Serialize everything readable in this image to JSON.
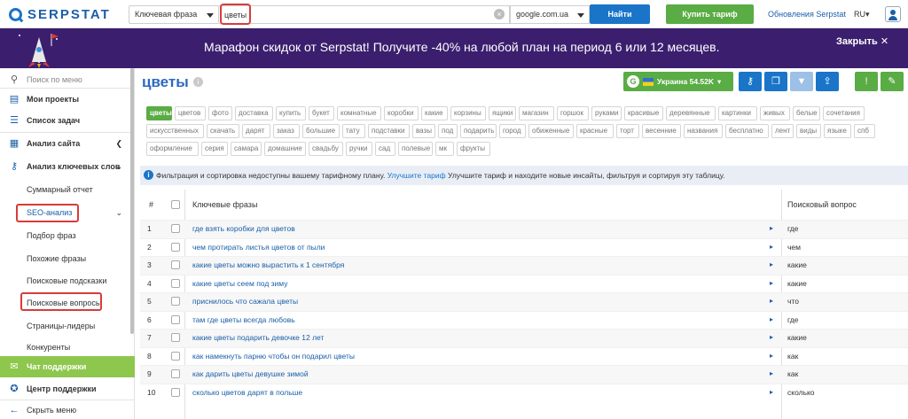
{
  "header": {
    "logo_text": "SERPSTAT",
    "search_type": "Ключевая фраза",
    "search_value": "цветы",
    "database": "google.com.ua",
    "find_label": "Найти",
    "buy_label": "Купить тариф",
    "updates_label": "Обновления Serpstat",
    "lang_label": "RU"
  },
  "banner": {
    "text": "Марафон скидок от Serpstat! Получите -40% на любой план на период 6 или 12 месяцев.",
    "close_label": "Закрыть ✕"
  },
  "sidebar": {
    "search_placeholder": "Поиск по меню",
    "my_projects": "Мои проекты",
    "task_list": "Список задач",
    "site_analysis": "Анализ сайта",
    "keyword_analysis": "Анализ ключевых слов",
    "summary_report": "Суммарный отчет",
    "seo_analysis": "SEO-анализ",
    "phrase_selection": "Подбор фраз",
    "similar_phrases": "Похожие фразы",
    "search_suggestions": "Поисковые подсказки",
    "search_questions": "Поисковые вопросы",
    "top_pages": "Страницы-лидеры",
    "competitors": "Конкуренты",
    "support_chat": "Чат поддержки",
    "help_center": "Центр поддержки",
    "collapse_menu": "Скрыть меню"
  },
  "main": {
    "title": "цветы",
    "region_label": "Украина 54.52K",
    "tags": [
      "цветы",
      "цветов",
      "фото",
      "доставка",
      "купить",
      "букет",
      "комнатные",
      "коробки",
      "какие",
      "корзины",
      "ящики",
      "магазин",
      "горшок",
      "руками",
      "красивые",
      "деревянные",
      "картинки",
      "живых",
      "белые",
      "сочетания",
      "искусственных",
      "скачать",
      "дарят",
      "заказ",
      "большие",
      "тату",
      "подставки",
      "вазы",
      "под",
      "подарить",
      "город",
      "обиженные",
      "красные",
      "торт",
      "весенние",
      "названия",
      "бесплатно",
      "лент",
      "виды",
      "языке",
      "спб",
      "оформление",
      "серия",
      "самара",
      "домашние",
      "свадьбу",
      "ручки",
      "сад",
      "полевые",
      "мк",
      "фрукты"
    ],
    "notice_text": "Фильтрация и сортировка недоступны вашему тарифному плану.",
    "notice_link": "Улучшите тариф",
    "notice_rest": "Улучшите тариф и находите новые инсайты, фильтруя и сортируя эту таблицу.",
    "col_num": "#",
    "col_keywords": "Ключевые фразы",
    "col_question": "Поисковый вопрос",
    "rows": [
      {
        "n": "1",
        "kw": "где взять коробки для цветов",
        "q": "где"
      },
      {
        "n": "2",
        "kw": "чем протирать листья цветов от пыли",
        "q": "чем"
      },
      {
        "n": "3",
        "kw": "какие цветы можно вырастить к 1 сентября",
        "q": "какие"
      },
      {
        "n": "4",
        "kw": "какие цветы сеем под зиму",
        "q": "какие"
      },
      {
        "n": "5",
        "kw": "приснилось что сажала цветы",
        "q": "что"
      },
      {
        "n": "6",
        "kw": "там где цветы всегда любовь",
        "q": "где"
      },
      {
        "n": "7",
        "kw": "какие цветы подарить девочке 12 лет",
        "q": "какие"
      },
      {
        "n": "8",
        "kw": "как намекнуть парню чтобы он подарил цветы",
        "q": "как"
      },
      {
        "n": "9",
        "kw": "как дарить цветы девушке зимой",
        "q": "как"
      },
      {
        "n": "10",
        "kw": "сколько цветов дарят в польше",
        "q": "сколько"
      }
    ]
  },
  "colors": {
    "brand_blue": "#1a75c9",
    "green": "#5aac44",
    "banner": "#3b1f6e",
    "highlight": "#d93b3b"
  }
}
